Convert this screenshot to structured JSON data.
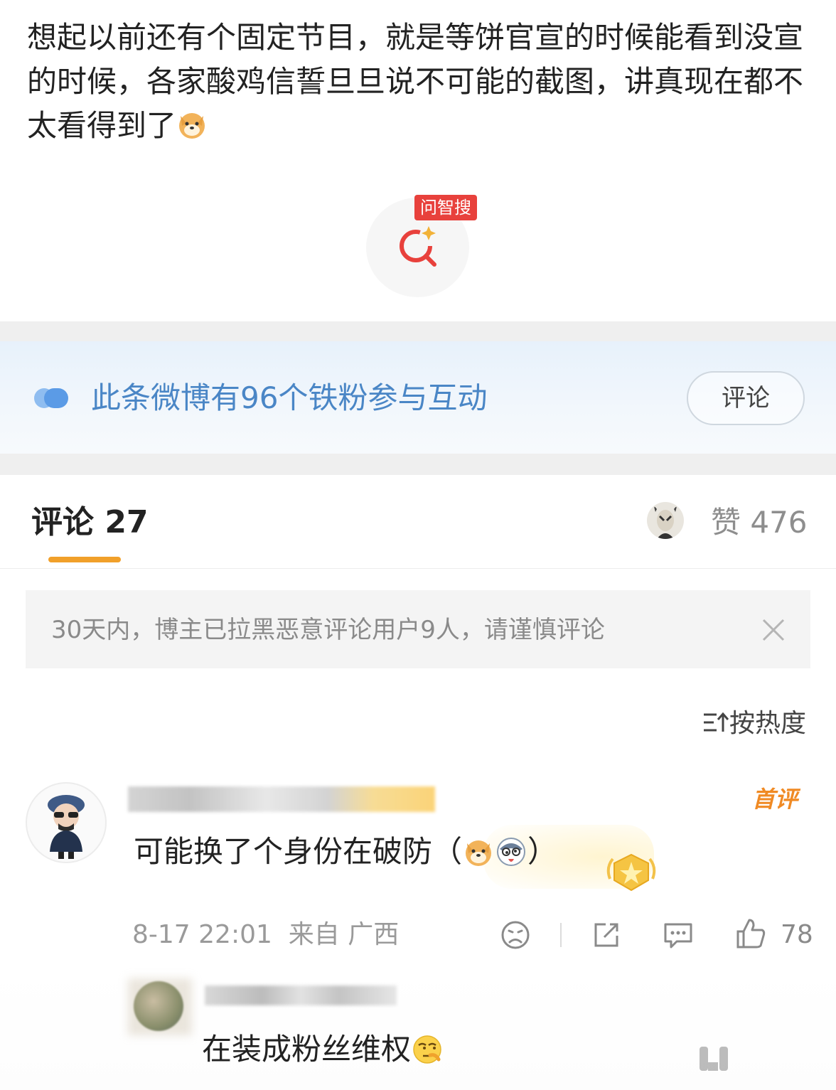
{
  "post": {
    "text": "想起以前还有个固定节目，就是等饼官宣的时候能看到没宣的时候，各家酸鸡信誓旦旦说不可能的截图，讲真现在都不太看得到了",
    "trailing_emoji": "doge-emoji"
  },
  "ai_search": {
    "badge": "问智搜",
    "icon": "sparkle-search-icon",
    "accent": "#e8413c"
  },
  "fans_banner": {
    "text": "此条微博有96个铁粉参与互动",
    "button": "评论",
    "color": "#4a86c6"
  },
  "tabs": {
    "comments_label": "评论 27",
    "likes_label": "赞 476",
    "underline_color": "#f1a02a"
  },
  "notice": {
    "text": "30天内，博主已拉黑恶意评论用户9人，请谨慎评论"
  },
  "sort": {
    "label": "按热度"
  },
  "comments": [
    {
      "badge": "首评",
      "text": "可能换了个身份在破防（",
      "emojis": [
        "doge-emoji",
        "husky-emoji"
      ],
      "text_end": "）",
      "time": "8-17 22:01",
      "source": "来自 广西",
      "likes": "78"
    },
    {
      "text": "在装成粉丝维权",
      "emoji": "side-eye-emoji"
    }
  ]
}
